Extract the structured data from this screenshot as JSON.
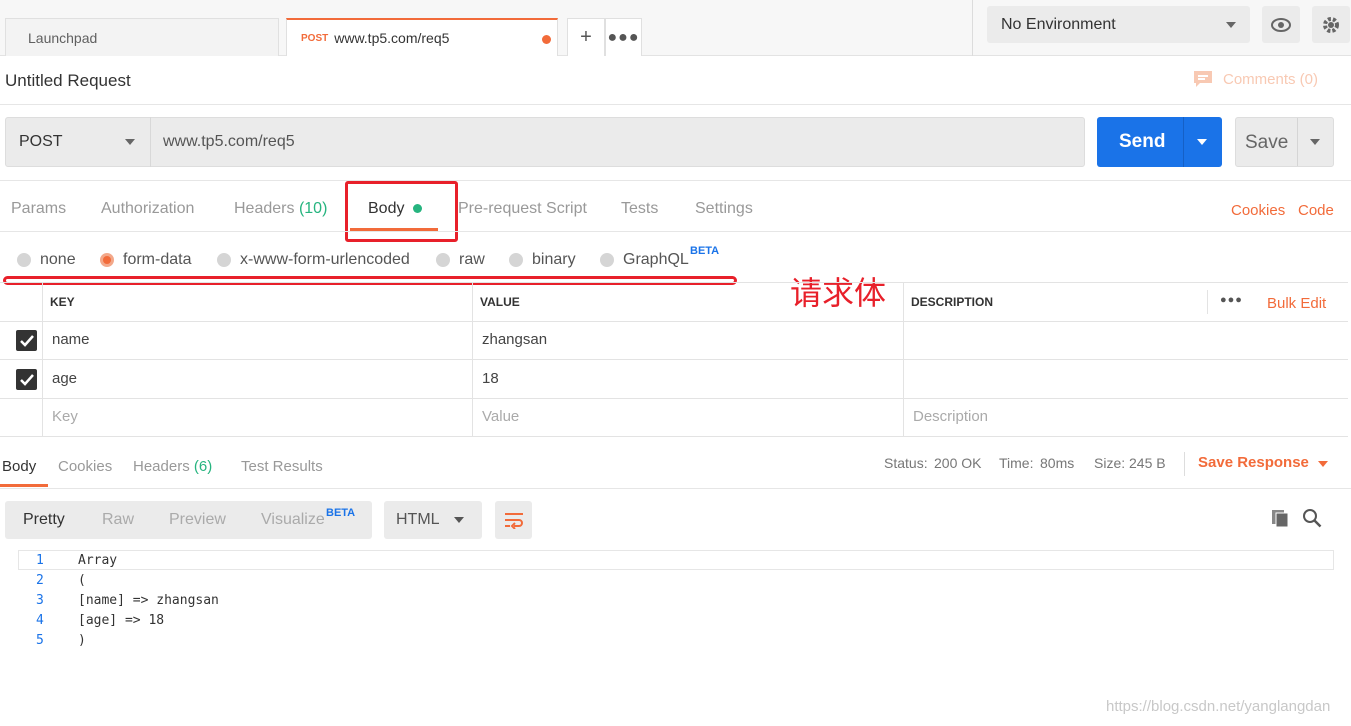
{
  "tabs": {
    "launchpad": "Launchpad",
    "active_method": "POST",
    "active_url": "www.tp5.com/req5"
  },
  "environment": {
    "selected": "No Environment"
  },
  "request": {
    "name": "Untitled Request",
    "comments": "Comments (0)",
    "method": "POST",
    "url": "www.tp5.com/req5",
    "send": "Send",
    "save": "Save"
  },
  "req_tabs": {
    "params": "Params",
    "authorization": "Authorization",
    "headers": "Headers",
    "headers_count": "(10)",
    "body": "Body",
    "prerequest": "Pre-request Script",
    "tests": "Tests",
    "settings": "Settings",
    "cookies": "Cookies",
    "code": "Code"
  },
  "body_types": {
    "none": "none",
    "form_data": "form-data",
    "urlencoded": "x-www-form-urlencoded",
    "raw": "raw",
    "binary": "binary",
    "graphql": "GraphQL",
    "beta": "BETA",
    "selected": "form-data"
  },
  "annotation": "请求体",
  "table": {
    "headers": {
      "key": "KEY",
      "value": "VALUE",
      "description": "DESCRIPTION",
      "bulk_edit": "Bulk Edit"
    },
    "rows": [
      {
        "key": "name",
        "value": "zhangsan",
        "checked": true
      },
      {
        "key": "age",
        "value": "18",
        "checked": true
      }
    ],
    "placeholders": {
      "key": "Key",
      "value": "Value",
      "description": "Description"
    }
  },
  "response": {
    "tabs": {
      "body": "Body",
      "cookies": "Cookies",
      "headers": "Headers",
      "headers_count": "(6)",
      "test_results": "Test Results"
    },
    "status_label": "Status:",
    "status": "200 OK",
    "time_label": "Time:",
    "time": "80ms",
    "size_label": "Size:",
    "size": "245 B",
    "save_response": "Save Response",
    "formats": {
      "pretty": "Pretty",
      "raw": "Raw",
      "preview": "Preview",
      "visualize": "Visualize",
      "beta": "BETA"
    },
    "language": "HTML",
    "lines": [
      "Array",
      "(",
      "[name] => zhangsan",
      "[age] => 18",
      ")"
    ],
    "line_numbers": [
      "1",
      "2",
      "3",
      "4",
      "5"
    ]
  },
  "watermark": "https://blog.csdn.net/yanglangdan"
}
